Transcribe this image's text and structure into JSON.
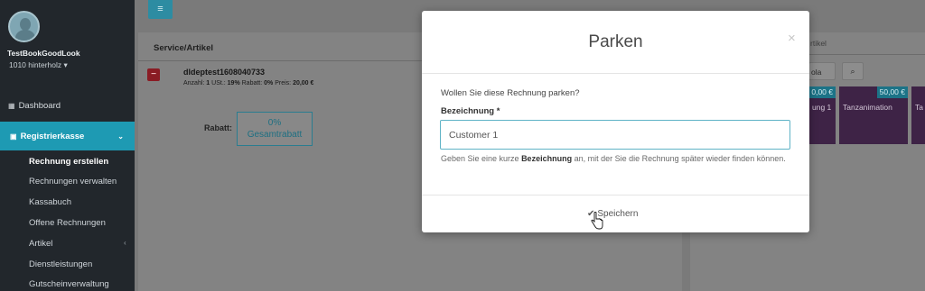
{
  "sidebar": {
    "shop_name": "TestBookGoodLook",
    "shop_sub": "1010 hinterholz",
    "dashboard": "Dashboard",
    "kasse": "Registrierkasse",
    "items": [
      {
        "label": "Rechnung erstellen"
      },
      {
        "label": "Rechnungen verwalten"
      },
      {
        "label": "Kassabuch"
      },
      {
        "label": "Offene Rechnungen"
      },
      {
        "label": "Artikel"
      },
      {
        "label": "Dienstleistungen"
      },
      {
        "label": "Gutscheinverwaltung"
      }
    ]
  },
  "main": {
    "column_header": "Service/Artikel",
    "item": {
      "title": "dldeptest1608040733",
      "meta_prefix": "Anzahl: ",
      "qty": "1",
      "meta_ust": " USt.: ",
      "ust": "19%",
      "meta_rabatt": " Rabatt: ",
      "rabatt": "0%",
      "meta_preis": " Preis: ",
      "preis": "20,00 €"
    },
    "rabatt_label": "Rabatt:",
    "rabatt_value": "0%",
    "rabatt_text": "Gesamtrabatt"
  },
  "right": {
    "header": "rtikel",
    "category": "ola",
    "tiles": [
      {
        "price": "0,00 €",
        "label": "ung 1"
      },
      {
        "price": "50,00 €",
        "label": "Tanzanimation"
      },
      {
        "price": "",
        "label": "Ta"
      }
    ]
  },
  "modal": {
    "title": "Parken",
    "close": "×",
    "question": "Wollen Sie diese Rechnung parken?",
    "field_label": "Bezeichnung *",
    "input_value": "Customer 1",
    "help_pre": "Geben Sie eine kurze ",
    "help_bold": "Bezeichnung",
    "help_post": " an, mit der Sie die Rechnung später wieder finden können.",
    "save_label": "Speichern"
  }
}
